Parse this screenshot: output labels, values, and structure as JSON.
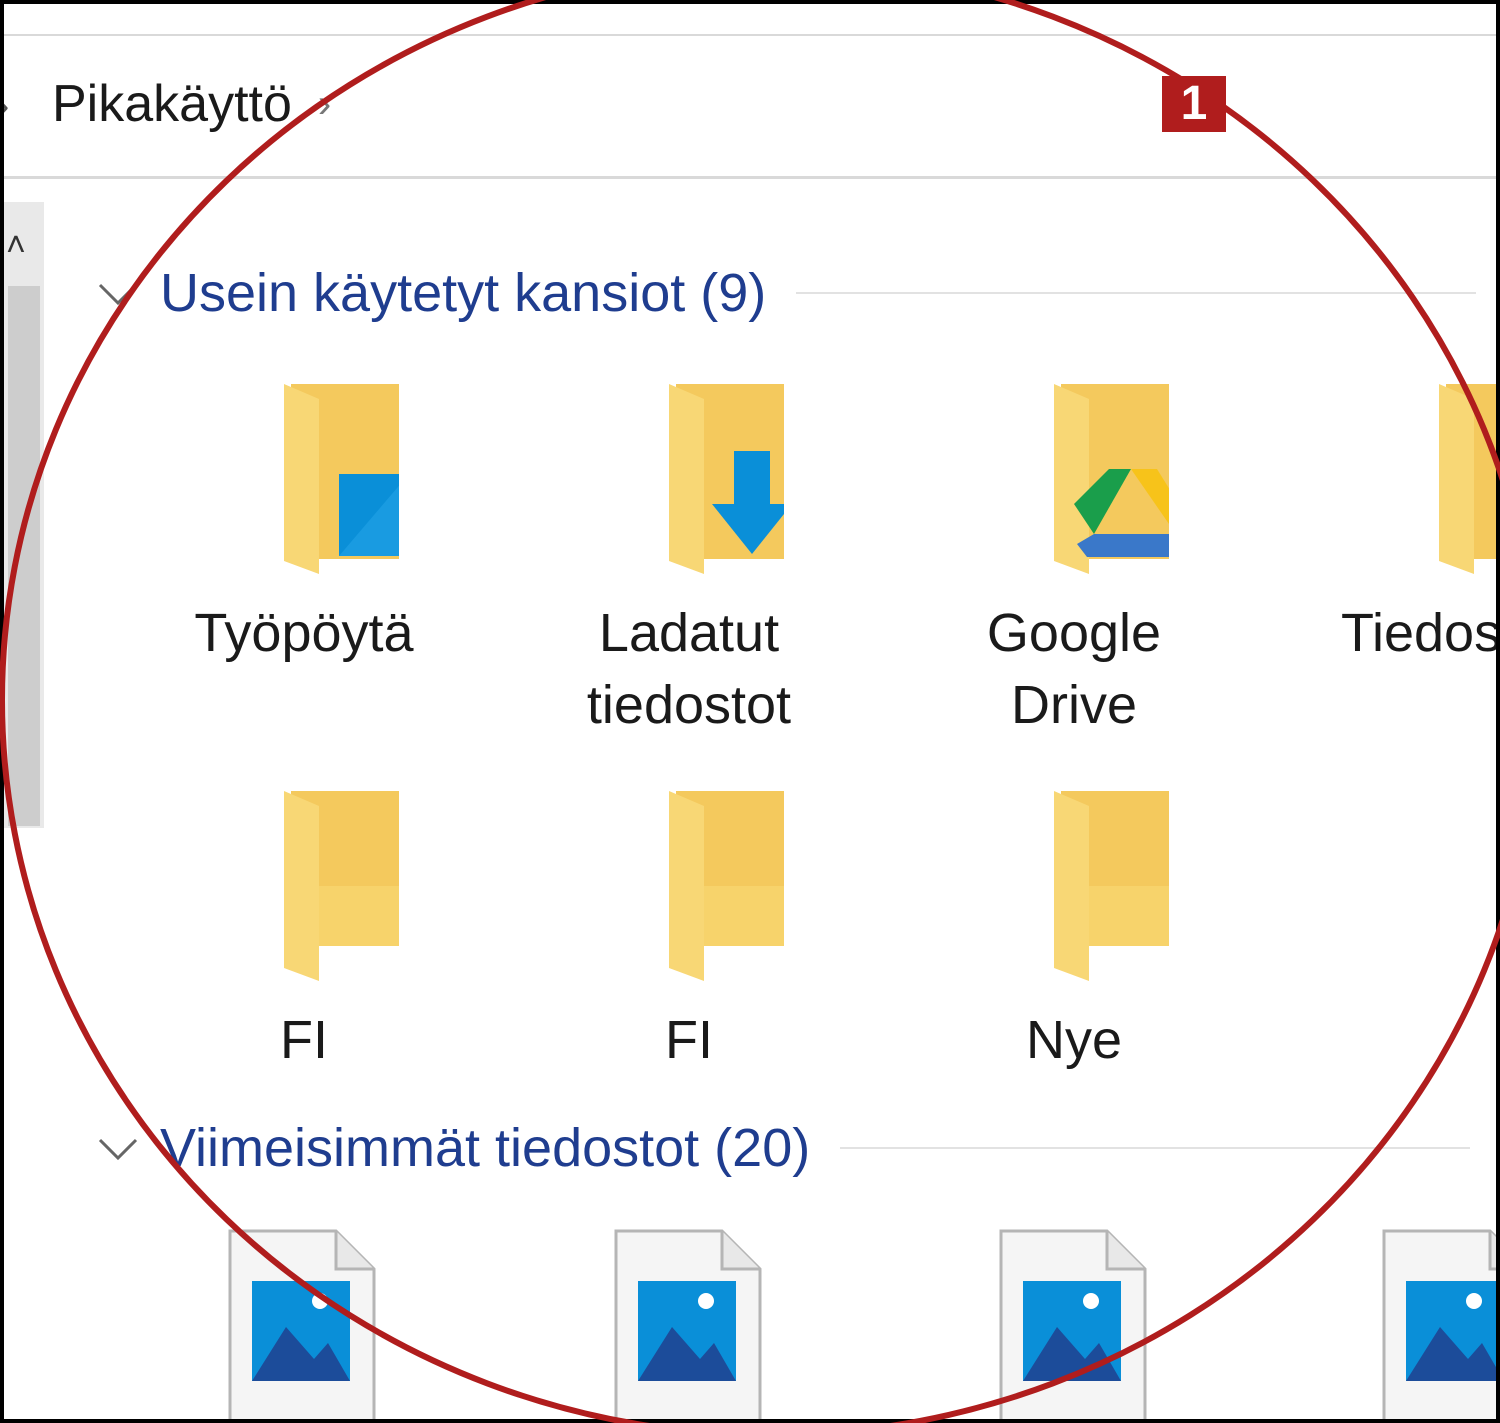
{
  "breadcrumb": {
    "location": "Pikakäyttö",
    "separator": "›"
  },
  "groups": {
    "frequent": {
      "title": "Usein käytetyt kansiot (9)"
    },
    "recent": {
      "title": "Viimeisimmät tiedostot (20)"
    }
  },
  "folders": [
    {
      "label_line1": "Työpöytä",
      "label_line2": "",
      "icon": "desktop-folder-icon"
    },
    {
      "label_line1": "Ladatut",
      "label_line2": "tiedostot",
      "icon": "downloads-folder-icon"
    },
    {
      "label_line1": "Google",
      "label_line2": "Drive",
      "icon": "google-drive-folder-icon"
    },
    {
      "label_line1": "Tiedos",
      "label_line2": "",
      "icon": "documents-folder-icon"
    },
    {
      "label_line1": "FI",
      "label_line2": "",
      "icon": "folder-icon"
    },
    {
      "label_line1": "FI",
      "label_line2": "",
      "icon": "folder-icon"
    },
    {
      "label_line1": "Nye",
      "label_line2": "",
      "icon": "folder-icon"
    }
  ],
  "recent_files": [
    {
      "icon": "image-file-icon"
    },
    {
      "icon": "image-file-icon"
    },
    {
      "icon": "image-file-icon"
    },
    {
      "icon": "image-file-icon"
    }
  ],
  "annotation": {
    "badge": "1",
    "color": "#b01d1d"
  },
  "colors": {
    "group_title": "#1f3d8f",
    "folder": "#f8d775",
    "folder_shade": "#e9b949",
    "accent_blue": "#0a8fd8"
  }
}
